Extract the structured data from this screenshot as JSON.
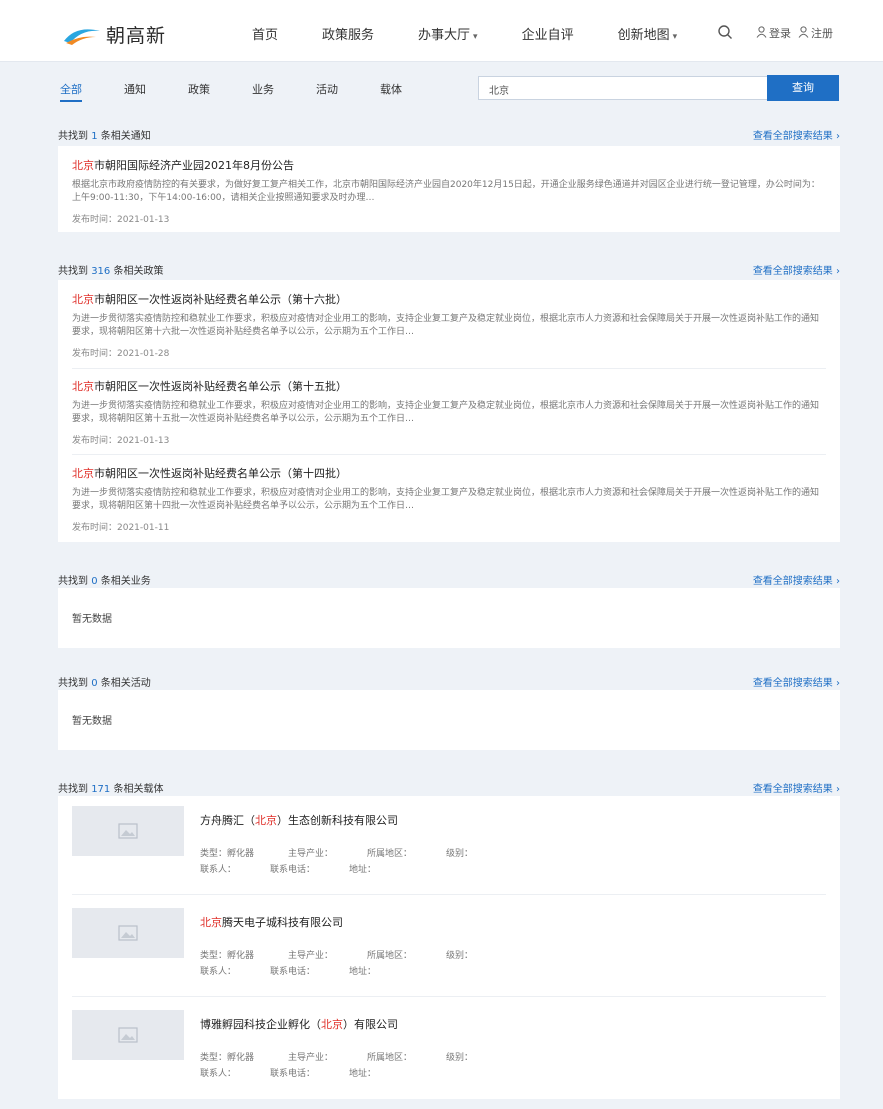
{
  "brand": {
    "name": "朝高新"
  },
  "nav": [
    {
      "label": "首页",
      "caret": ""
    },
    {
      "label": "政策服务",
      "caret": ""
    },
    {
      "label": "办事大厅",
      "caret": "▾"
    },
    {
      "label": "企业自评",
      "caret": ""
    },
    {
      "label": "创新地图",
      "caret": "▾"
    }
  ],
  "auth": {
    "login": "登录",
    "register": "注册"
  },
  "tabs": [
    "全部",
    "通知",
    "政策",
    "业务",
    "活动",
    "载体"
  ],
  "search": {
    "value": "北京",
    "button": "查询"
  },
  "sections": {
    "notice": {
      "head_prefix": "共找到",
      "count": "1",
      "head_suffix": "条相关通知",
      "more": "查看全部搜索结果 ›",
      "items": [
        {
          "hl": "北京",
          "rest": "市朝阳国际经济产业园2021年8月份公告",
          "desc": "根据北京市政府疫情防控的有关要求，为做好复工复产相关工作，北京市朝阳国际经济产业园自2020年12月15日起，开通企业服务绿色通道并对园区企业进行统一登记管理，办公时间为：上午9:00-11:30，下午14:00-16:00，请相关企业按照通知要求及时办理…",
          "date": "发布时间：2021-01-13"
        }
      ]
    },
    "policy": {
      "head_prefix": "共找到",
      "count": "316",
      "head_suffix": "条相关政策",
      "more": "查看全部搜索结果 ›",
      "items": [
        {
          "hl": "北京",
          "rest": "市朝阳区一次性返岗补贴经费名单公示（第十六批）",
          "desc": "为进一步贯彻落实疫情防控和稳就业工作要求，积极应对疫情对企业用工的影响，支持企业复工复产及稳定就业岗位，根据北京市人力资源和社会保障局关于开展一次性返岗补贴工作的通知要求，现将朝阳区第十六批一次性返岗补贴经费名单予以公示，公示期为五个工作日…",
          "date": "发布时间：2021-01-28"
        },
        {
          "hl": "北京",
          "rest": "市朝阳区一次性返岗补贴经费名单公示（第十五批）",
          "desc": "为进一步贯彻落实疫情防控和稳就业工作要求，积极应对疫情对企业用工的影响，支持企业复工复产及稳定就业岗位，根据北京市人力资源和社会保障局关于开展一次性返岗补贴工作的通知要求，现将朝阳区第十五批一次性返岗补贴经费名单予以公示，公示期为五个工作日…",
          "date": "发布时间：2021-01-13"
        },
        {
          "hl": "北京",
          "rest": "市朝阳区一次性返岗补贴经费名单公示（第十四批）",
          "desc": "为进一步贯彻落实疫情防控和稳就业工作要求，积极应对疫情对企业用工的影响，支持企业复工复产及稳定就业岗位，根据北京市人力资源和社会保障局关于开展一次性返岗补贴工作的通知要求，现将朝阳区第十四批一次性返岗补贴经费名单予以公示，公示期为五个工作日…",
          "date": "发布时间：2021-01-11"
        }
      ]
    },
    "business": {
      "head_prefix": "共找到",
      "count": "0",
      "head_suffix": "条相关业务",
      "more": "查看全部搜索结果 ›",
      "empty": "暂无数据"
    },
    "activity": {
      "head_prefix": "共找到",
      "count": "0",
      "head_suffix": "条相关活动",
      "more": "查看全部搜索结果 ›",
      "empty": "暂无数据"
    },
    "carrier": {
      "head_prefix": "共找到",
      "count": "171",
      "head_suffix": "条相关载体",
      "more": "查看全部搜索结果 ›",
      "items": [
        {
          "pre": "方舟腾汇（",
          "hl": "北京",
          "post": "）生态创新科技有限公司",
          "type": "类型：孵化器",
          "industry": "主导产业：",
          "area": "所属地区：",
          "extra": "级别：",
          "contact": "联系人：",
          "phone": "联系电话：",
          "addr": "地址："
        },
        {
          "pre": "",
          "hl": "北京",
          "post": "腾天电子城科技有限公司",
          "type": "类型：孵化器",
          "industry": "主导产业：",
          "area": "所属地区：",
          "extra": "级别：",
          "contact": "联系人：",
          "phone": "联系电话：",
          "addr": "地址："
        },
        {
          "pre": "博雅孵园科技企业孵化（",
          "hl": "北京",
          "post": "）有限公司",
          "type": "类型：孵化器",
          "industry": "主导产业：",
          "area": "所属地区：",
          "extra": "级别：",
          "contact": "联系人：",
          "phone": "联系电话：",
          "addr": "地址："
        }
      ]
    }
  }
}
